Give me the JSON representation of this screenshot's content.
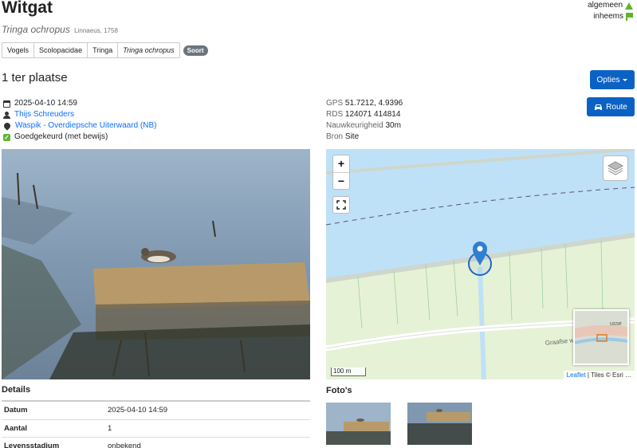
{
  "species": {
    "common_name": "Witgat",
    "scientific_name": "Tringa ochropus",
    "author": "Linnaeus, 1758"
  },
  "status": {
    "abundance": "algemeen",
    "origin": "inheems",
    "abundance_icon": "triangle-icon",
    "origin_icon": "flag-icon",
    "color": "#5cb531"
  },
  "taxonomy": {
    "crumbs": [
      "Vogels",
      "Scolopacidae",
      "Tringa",
      "Tringa ochropus"
    ],
    "rank_badge": "Soort"
  },
  "observation": {
    "heading": "1 ter plaatse",
    "datetime": "2025-04-10 14:59",
    "observer": "Thijs Schreuders",
    "location": "Waspik - Overdiepsche Uiterwaard (NB)",
    "validation": "Goedgekeurd (met bewijs)"
  },
  "buttons": {
    "opties": "Opties",
    "route": "Route",
    "color": "#0b62c4"
  },
  "geo": {
    "gps_label": "GPS",
    "gps_value": "51.7212, 4.9396",
    "rds_label": "RDS",
    "rds_value": "124071 414814",
    "accuracy_label": "Nauwkeurigheid",
    "accuracy_value": "30m",
    "source_label": "Bron",
    "source_value": "Site"
  },
  "map": {
    "zoom_in": "+",
    "zoom_out": "−",
    "scale": "100 m",
    "attribution_link": "Leaflet",
    "attribution_text": " | Tiles © Esri …",
    "street_label": "Graafse w",
    "minimap_label": "usse"
  },
  "details": {
    "title": "Details",
    "rows": [
      {
        "label": "Datum",
        "value": "2025-04-10 14:59"
      },
      {
        "label": "Aantal",
        "value": "1"
      },
      {
        "label": "Levensstadium",
        "value": "onbekend"
      }
    ]
  },
  "photos": {
    "title": "Foto's"
  }
}
